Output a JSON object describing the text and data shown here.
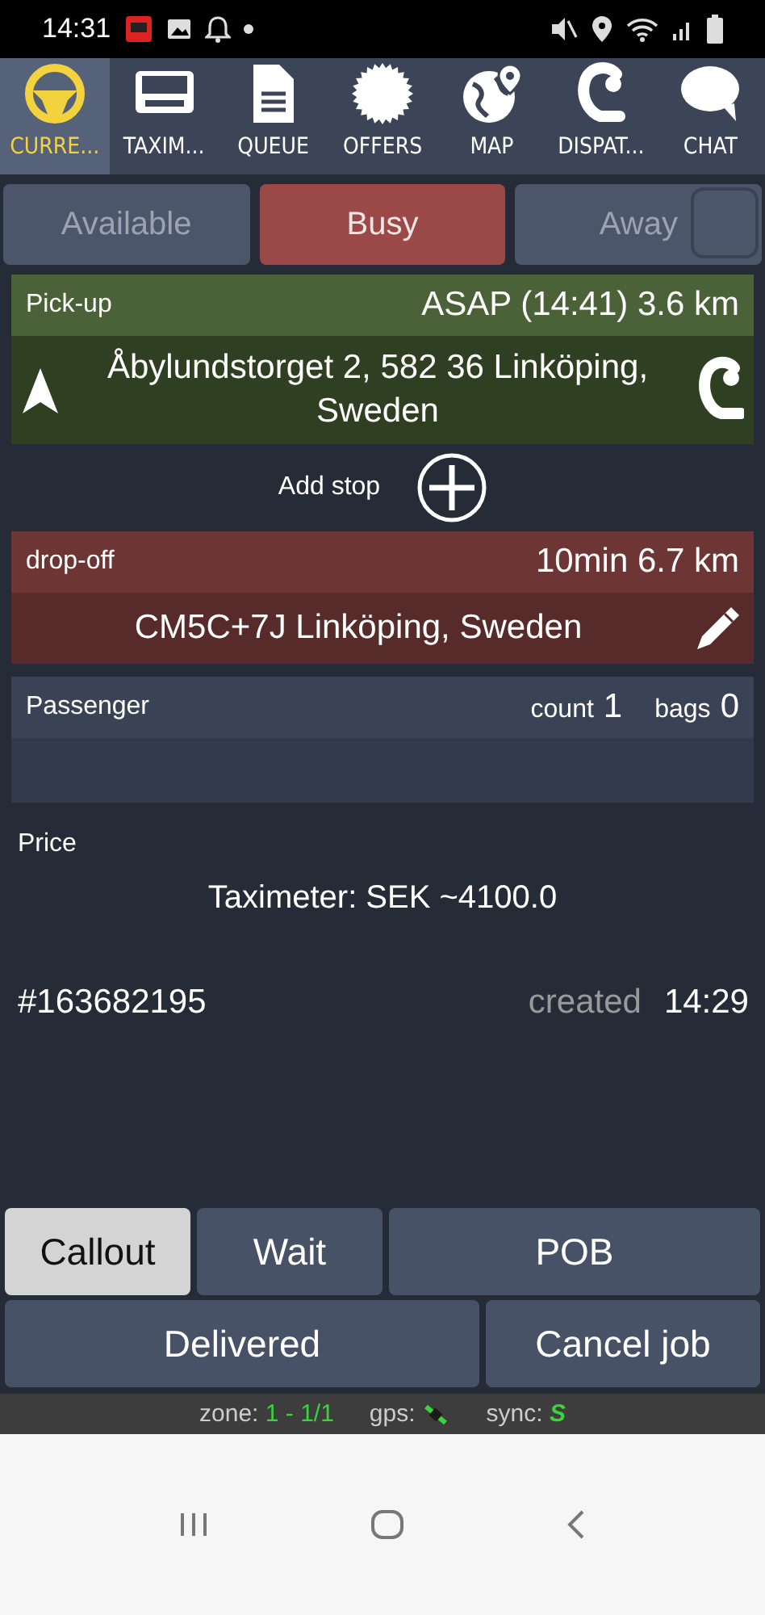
{
  "status_bar": {
    "time": "14:31"
  },
  "tabs": [
    {
      "label": "CURRE...",
      "kind": "wheel",
      "selected": true
    },
    {
      "label": "TAXIM...",
      "kind": "meter",
      "selected": false
    },
    {
      "label": "QUEUE",
      "kind": "doc",
      "selected": false
    },
    {
      "label": "OFFERS",
      "kind": "seal",
      "selected": false
    },
    {
      "label": "MAP",
      "kind": "globe",
      "selected": false
    },
    {
      "label": "DISPAT...",
      "kind": "headset",
      "selected": false
    },
    {
      "label": "CHAT",
      "kind": "bubble",
      "selected": false
    }
  ],
  "availability": [
    {
      "label": "Available",
      "selected": false
    },
    {
      "label": "Busy",
      "selected": true
    },
    {
      "label": "Away",
      "selected": false
    }
  ],
  "pickup": {
    "label": "Pick-up",
    "eta": "ASAP (14:41) 3.6 km",
    "address": "Åbylundstorget 2, 582 36 Linköping, Sweden"
  },
  "add_stop": {
    "label": "Add stop"
  },
  "dropoff": {
    "label": "drop-off",
    "eta": "10min 6.7 km",
    "address": "CM5C+7J Linköping, Sweden"
  },
  "passenger": {
    "label": "Passenger",
    "count_label": "count",
    "count": "1",
    "bags_label": "bags",
    "bags": "0"
  },
  "price": {
    "label": "Price",
    "value": "Taximeter: SEK ~4100.0"
  },
  "job": {
    "number": "#163682195",
    "created_label": "created",
    "created": "14:29"
  },
  "actions": [
    {
      "label": "Callout",
      "selected": true
    },
    {
      "label": "Wait",
      "selected": false
    },
    {
      "label": "POB",
      "selected": false
    },
    {
      "label": "Delivered",
      "selected": false
    },
    {
      "label": "Cancel job",
      "selected": false
    }
  ],
  "footer": {
    "zone_label": "zone:",
    "zone": "1 - 1/1",
    "gps_label": "gps:",
    "sync_label": "sync:",
    "sync": "S"
  }
}
